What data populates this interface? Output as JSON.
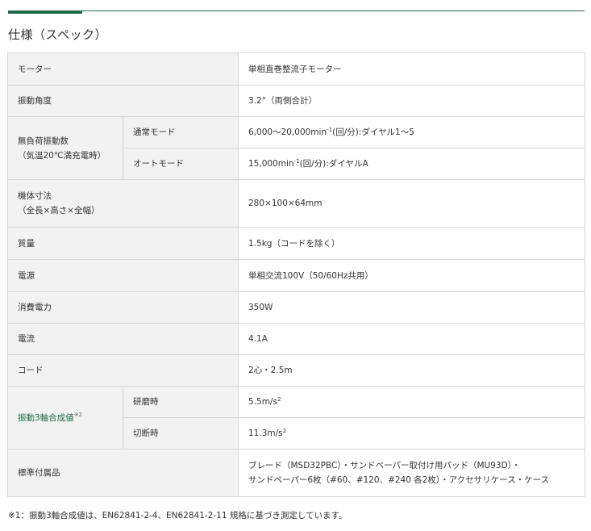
{
  "section_title": "仕様（スペック）",
  "rows": {
    "motor": {
      "label": "モーター",
      "value": "単相直巻整流子モーター"
    },
    "angle": {
      "label": "振動角度",
      "value": "3.2°（両側合計）"
    },
    "no_load": {
      "label_line1": "無負荷振動数",
      "label_line2": "（気温20℃満充電時）",
      "normal": {
        "label": "通常モード",
        "value_prefix": "6,000～20,000min",
        "value_sup": "-1",
        "value_suffix": "(回/分):ダイヤル1～5"
      },
      "auto": {
        "label": "オートモード",
        "value_prefix": "15,000min",
        "value_sup": "-1",
        "value_suffix": "(回/分):ダイヤルA"
      }
    },
    "dimensions": {
      "label_line1": "機体寸法",
      "label_line2": "（全長×高さ×全幅）",
      "value": "280×100×64mm"
    },
    "mass": {
      "label": "質量",
      "value": "1.5kg（コードを除く）"
    },
    "power_source": {
      "label": "電源",
      "value": "単相交流100V（50/60Hz共用）"
    },
    "consumption": {
      "label": "消費電力",
      "value": "350W"
    },
    "current": {
      "label": "電流",
      "value": "4.1A"
    },
    "cord": {
      "label": "コード",
      "value": "2心・2.5m"
    },
    "vibration": {
      "label": "振動3軸合成値",
      "note_mark": "※2",
      "grinding": {
        "label": "研磨時",
        "value_prefix": "5.5m/s",
        "value_sup": "2"
      },
      "cutting": {
        "label": "切断時",
        "value_prefix": "11.3m/s",
        "value_sup": "2"
      }
    },
    "accessories": {
      "label": "標準付属品",
      "value_line1": "ブレード（MSD32PBC）・サンドペーパー取付け用パッド（MU93D）・",
      "value_line2": "サンドペーパー6枚（#60、#120、#240 各2枚）・アクセサリケース・ケース"
    }
  },
  "footnote": "※1：振動3軸合成値は、EN62841-2-4、EN62841-2-11 規格に基づき測定しています。",
  "colors": {
    "accent": "#1f6b4a",
    "header_bg": "#f2f2f2",
    "border": "#d7d7d7",
    "text": "#333333"
  }
}
